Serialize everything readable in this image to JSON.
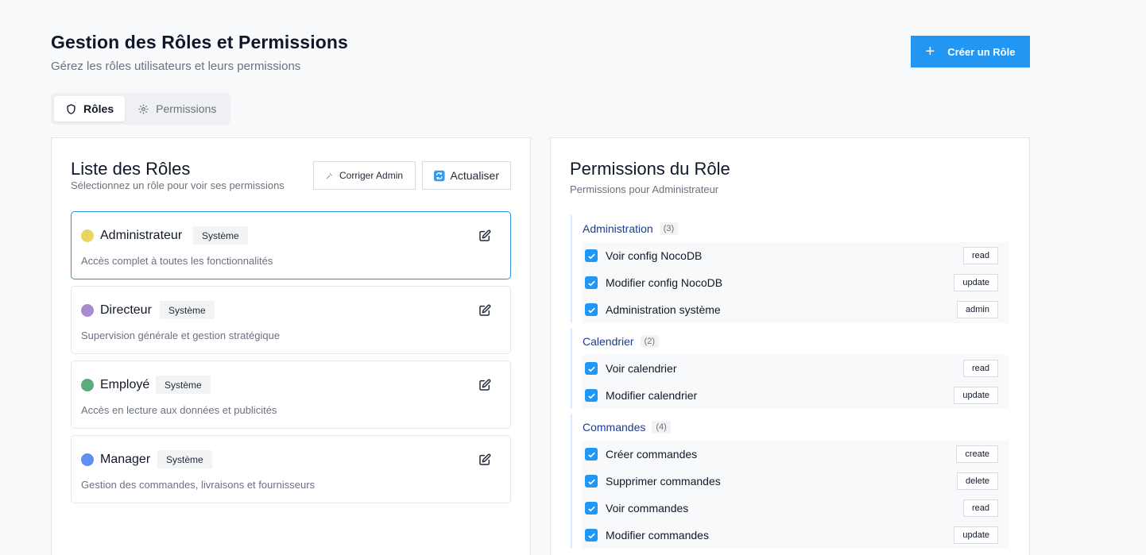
{
  "header": {
    "title": "Gestion des Rôles et Permissions",
    "subtitle": "Gérez les rôles utilisateurs et leurs permissions",
    "create_label": "Créer un Rôle"
  },
  "tabs": [
    {
      "label": "Rôles",
      "icon": "shield-icon",
      "active": true
    },
    {
      "label": "Permissions",
      "icon": "gear-icon",
      "active": false
    }
  ],
  "roles_panel": {
    "title": "Liste des Rôles",
    "subtitle": "Sélectionnez un rôle pour voir ses permissions",
    "fix_admin_label": "Corriger Admin",
    "refresh_label": "Actualiser",
    "roles": [
      {
        "name": "Administrateur",
        "badge": "Système",
        "description": "Accès complet à toutes les fonctionnalités",
        "color": "#e8d562",
        "selected": true
      },
      {
        "name": "Directeur",
        "badge": "Système",
        "description": "Supervision générale et gestion stratégique",
        "color": "#a98bd0",
        "selected": false
      },
      {
        "name": "Employé",
        "badge": "Système",
        "description": "Accès en lecture aux données et publicités",
        "color": "#5aad7a",
        "selected": false
      },
      {
        "name": "Manager",
        "badge": "Système",
        "description": "Gestion des commandes, livraisons et fournisseurs",
        "color": "#5f8ff0",
        "selected": false
      }
    ]
  },
  "permissions_panel": {
    "title": "Permissions du Rôle",
    "subtitle": "Permissions pour Administrateur",
    "groups": [
      {
        "name": "Administration",
        "count": "(3)",
        "items": [
          {
            "label": "Voir config NocoDB",
            "action": "read",
            "checked": true
          },
          {
            "label": "Modifier config NocoDB",
            "action": "update",
            "checked": true
          },
          {
            "label": "Administration système",
            "action": "admin",
            "checked": true
          }
        ]
      },
      {
        "name": "Calendrier",
        "count": "(2)",
        "items": [
          {
            "label": "Voir calendrier",
            "action": "read",
            "checked": true
          },
          {
            "label": "Modifier calendrier",
            "action": "update",
            "checked": true
          }
        ]
      },
      {
        "name": "Commandes",
        "count": "(4)",
        "items": [
          {
            "label": "Créer commandes",
            "action": "create",
            "checked": true
          },
          {
            "label": "Supprimer commandes",
            "action": "delete",
            "checked": true
          },
          {
            "label": "Voir commandes",
            "action": "read",
            "checked": true
          },
          {
            "label": "Modifier commandes",
            "action": "update",
            "checked": true
          }
        ]
      }
    ]
  },
  "colors": {
    "accent": "#2196f3",
    "selected_border": "#2b8fd3",
    "group_title": "#1e3a8a"
  }
}
